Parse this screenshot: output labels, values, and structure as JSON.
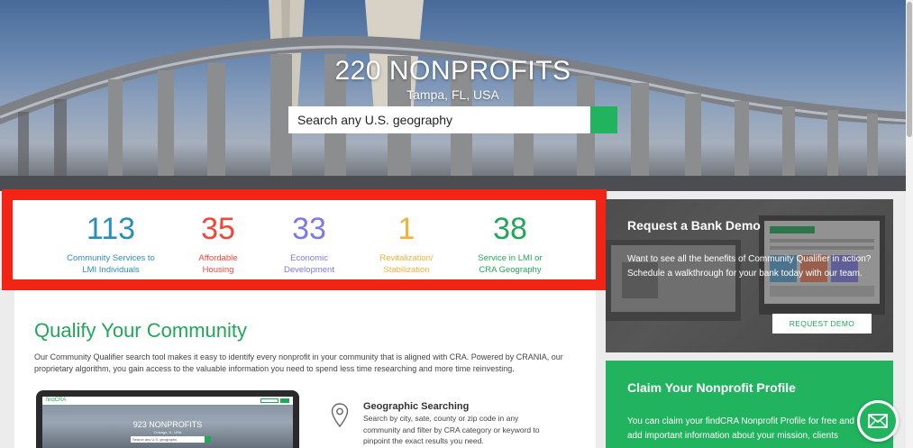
{
  "hero": {
    "title": "220 NONPROFITS",
    "location": "Tampa, FL, USA",
    "search_placeholder": "Search any U.S. geography",
    "search_icon": "search-icon"
  },
  "stats": [
    {
      "value": "113",
      "label": "Community Services to\nLMI Individuals",
      "color": "#2a8fb8"
    },
    {
      "value": "35",
      "label": "Affordable\nHousing",
      "color": "#f0473b"
    },
    {
      "value": "33",
      "label": "Economic\nDevelopment",
      "color": "#7b79e6"
    },
    {
      "value": "1",
      "label": "Revitalization/\nStabilization",
      "color": "#f2b23b"
    },
    {
      "value": "38",
      "label": "Service in LMI or\nCRA Geography",
      "color": "#22a65a"
    }
  ],
  "qualify": {
    "title": "Qualify Your Community",
    "text": "Our Community Qualifier search tool makes it easy to identify every nonprofit in your community that is aligned with CRA. Powered by CRANIA, our proprietary algorithm, you gain access to the valuable information you need to spend less time researching and more time reinvesting."
  },
  "laptop": {
    "logo": "findCRA",
    "title": "923 NONPROFITS",
    "sub": "Chicago, IL, USA",
    "search": "Search any U.S. geography"
  },
  "feature": {
    "icon": "location-pin-icon",
    "title": "Geographic Searching",
    "text": "Search by city, sate, county or zip code in any community and filter by CRA category or keyword to pinpoint the exact results you need."
  },
  "demo": {
    "title": "Request a Bank Demo",
    "text": "Want to see all the benefits of Community Qualifier in action? Schedule a walkthrough for your bank today with our team.",
    "button": "REQUEST DEMO"
  },
  "claim": {
    "title": "Claim Your Nonprofit Profile",
    "text": "You can claim your findCRA Nonprofit Profile for free and add important information about your mission, clients"
  },
  "colors": {
    "brand_green": "#22b35e",
    "highlight_red": "#f22416"
  },
  "mail_icon": "mail-icon"
}
